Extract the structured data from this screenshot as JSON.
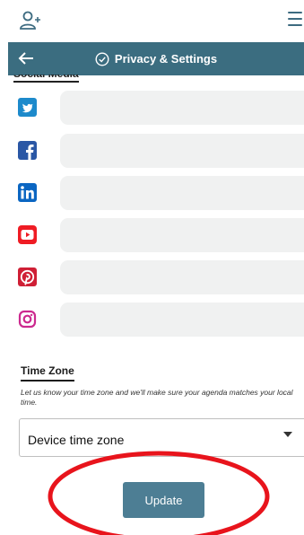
{
  "header": {
    "title": "Privacy & Settings"
  },
  "social_media": {
    "heading": "Social Media"
  },
  "social_links": [
    {
      "icon": "twitter-icon",
      "color": "#1d8acb",
      "value": ""
    },
    {
      "icon": "facebook-icon",
      "color": "#2a57a5",
      "value": ""
    },
    {
      "icon": "linkedin-icon",
      "color": "#0b66c2",
      "value": ""
    },
    {
      "icon": "youtube-icon",
      "color": "#ef1c24",
      "value": ""
    },
    {
      "icon": "pinterest-icon",
      "color": "#cf1f35",
      "value": ""
    },
    {
      "icon": "instagram-icon",
      "color": "#cc2a8f",
      "value": ""
    }
  ],
  "timezone": {
    "heading": "Time Zone",
    "help": "Let us know your time zone and we'll make sure your agenda matches your local time.",
    "selected": "Device time zone"
  },
  "actions": {
    "update_label": "Update"
  },
  "colors": {
    "header": "#3b6d80",
    "button": "#4d7e94",
    "input_bg": "#f0f1f1",
    "annotation": "#e8141c"
  }
}
